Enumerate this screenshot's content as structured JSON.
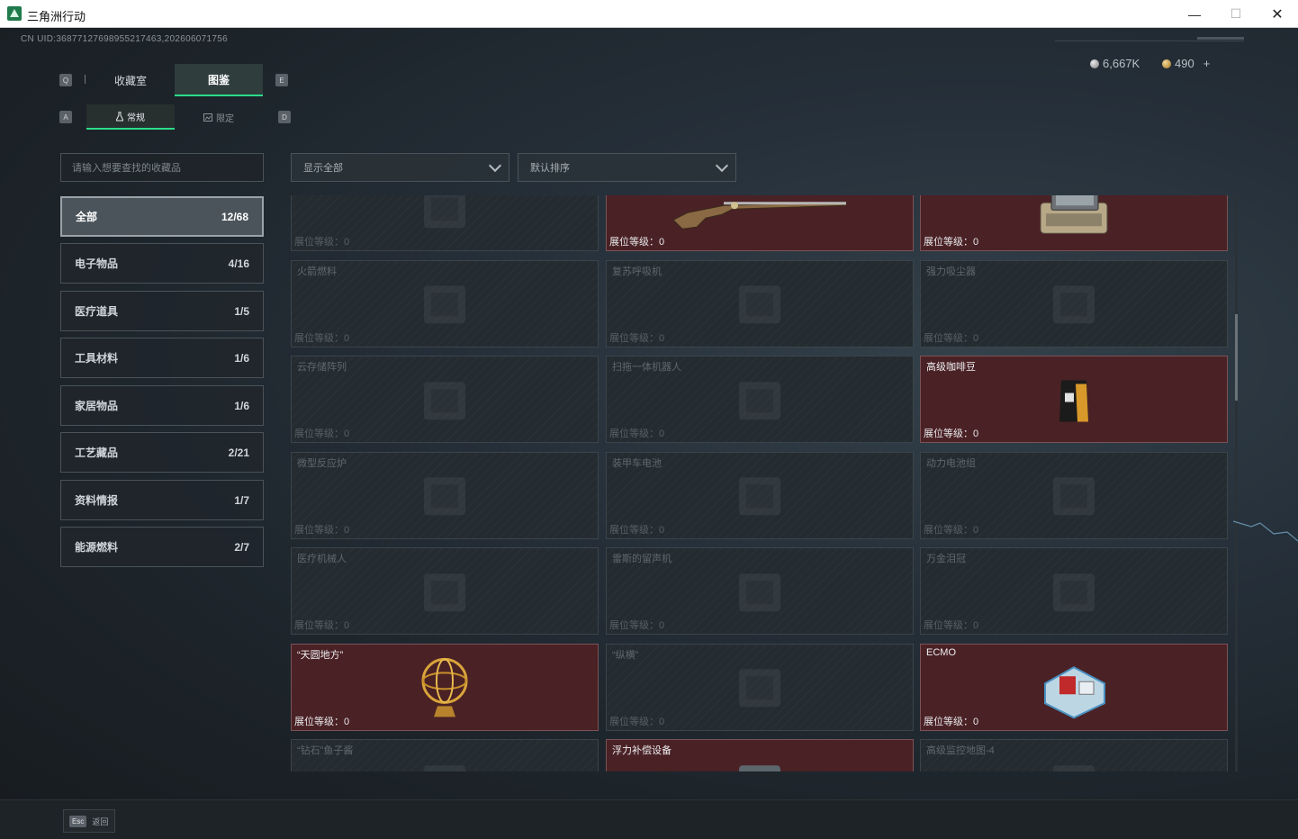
{
  "window": {
    "title": "三角洲行动",
    "min_label": "—",
    "max_label": "☐",
    "close_label": "✕"
  },
  "uid": "CN UID:3687712769895521746​3,202606071756",
  "currency": {
    "silver": "6,667K",
    "gold": "490",
    "add_label": "+"
  },
  "keys": {
    "q": "Q",
    "e": "E",
    "a": "A",
    "d": "D"
  },
  "tabs": [
    {
      "label": "收藏室"
    },
    {
      "label": "图鉴"
    }
  ],
  "subtabs": [
    {
      "label": "常规"
    },
    {
      "label": "限定"
    }
  ],
  "search": {
    "placeholder": "请输入想要查找的收藏品"
  },
  "filters": {
    "display": "显示全部",
    "sort": "默认排序"
  },
  "categories": [
    {
      "label": "全部",
      "count": "12/68"
    },
    {
      "label": "电子物品",
      "count": "4/16"
    },
    {
      "label": "医疗道具",
      "count": "1/5"
    },
    {
      "label": "工具材料",
      "count": "1/6"
    },
    {
      "label": "家居物品",
      "count": "1/6"
    },
    {
      "label": "工艺藏品",
      "count": "2/21"
    },
    {
      "label": "资料情报",
      "count": "1/7"
    },
    {
      "label": "能源燃料",
      "count": "2/7"
    }
  ],
  "level_label": "展位等级：",
  "level_value": "0",
  "items": [
    {
      "name": "",
      "owned": false,
      "icon": "cylinder-icon"
    },
    {
      "name": "",
      "owned": true,
      "icon": "rifle-icon"
    },
    {
      "name": "",
      "owned": true,
      "icon": "terminal-case-icon"
    },
    {
      "name": "火箭燃料",
      "owned": false,
      "icon": "fuel-can-icon"
    },
    {
      "name": "复苏呼吸机",
      "owned": false,
      "icon": "ventilator-icon"
    },
    {
      "name": "强力吸尘器",
      "owned": false,
      "icon": "vacuum-icon"
    },
    {
      "name": "云存储阵列",
      "owned": false,
      "icon": "server-array-icon"
    },
    {
      "name": "扫拖一体机器人",
      "owned": false,
      "icon": "robot-icon"
    },
    {
      "name": "高级咖啡豆",
      "owned": true,
      "icon": "coffee-bag-icon"
    },
    {
      "name": "微型反应炉",
      "owned": false,
      "icon": "reactor-icon"
    },
    {
      "name": "装甲车电池",
      "owned": false,
      "icon": "battery-icon"
    },
    {
      "name": "动力电池组",
      "owned": false,
      "icon": "battery-pack-icon"
    },
    {
      "name": "医疗机械人",
      "owned": false,
      "icon": "medical-robot-icon"
    },
    {
      "name": "雷斯的留声机",
      "owned": false,
      "icon": "gramophone-icon"
    },
    {
      "name": "万金泪冠",
      "owned": false,
      "icon": "crown-icon"
    },
    {
      "name": "“天圆地方”",
      "owned": true,
      "icon": "armillary-sphere-icon"
    },
    {
      "name": "“纵横”",
      "owned": false,
      "icon": "chessboard-icon"
    },
    {
      "name": "ECMO",
      "owned": true,
      "icon": "ecmo-icon"
    },
    {
      "name": "“钻石”鱼子酱",
      "owned": false,
      "icon": "caviar-icon"
    },
    {
      "name": "浮力补偿设备",
      "owned": true,
      "icon": "bcd-icon"
    },
    {
      "name": "高级监控地图-4",
      "owned": false,
      "icon": "map-icon"
    }
  ],
  "footer": {
    "esc_key": "Esc",
    "esc_label": "返回"
  },
  "colors": {
    "accent": "#2bdd8a",
    "owned_bg": "#4a2125",
    "locked_bg": "#252c31"
  }
}
